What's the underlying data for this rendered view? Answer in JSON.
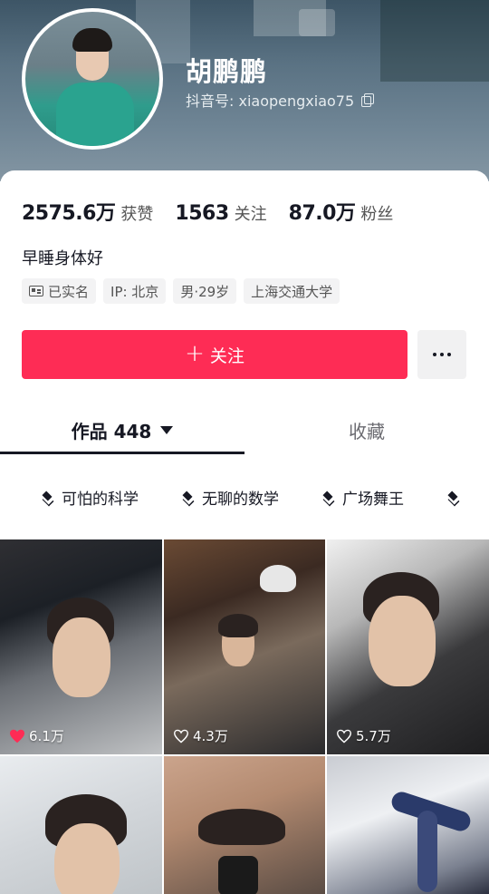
{
  "profile": {
    "name": "胡鹏鹏",
    "douyin_id": "抖音号: xiaopengxiao75",
    "stats": [
      {
        "value": "2575.6万",
        "label": "获赞"
      },
      {
        "value": "1563",
        "label": "关注"
      },
      {
        "value": "87.0万",
        "label": "粉丝"
      }
    ],
    "bio": "早睡身体好",
    "tags": {
      "verified": "已实名",
      "ip": "IP: 北京",
      "gender_age": "男·29岁",
      "school": "上海交通大学"
    }
  },
  "actions": {
    "follow_label": "关注",
    "follow_plus": "+",
    "follow_color": "#fe2c55"
  },
  "tabs": {
    "works": "作品 448",
    "favorites": "收藏"
  },
  "collections": [
    "可怕的科学",
    "无聊的数学",
    "广场舞王"
  ],
  "videos": [
    {
      "likes": "6.1万",
      "liked": true
    },
    {
      "likes": "4.3万",
      "liked": false
    },
    {
      "likes": "5.7万",
      "liked": false
    },
    {
      "likes": "",
      "liked": false
    },
    {
      "likes": "",
      "liked": false
    },
    {
      "likes": "",
      "liked": false
    }
  ]
}
